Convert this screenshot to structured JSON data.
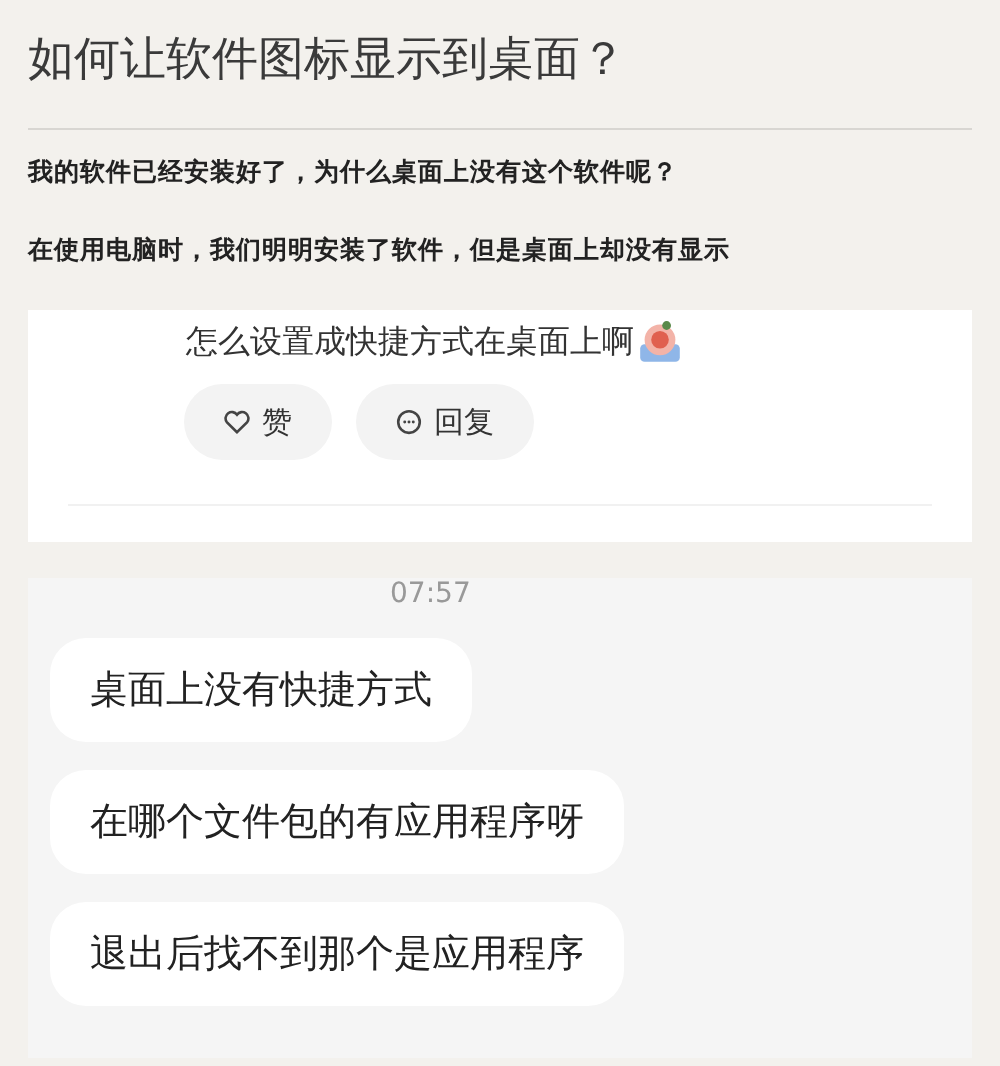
{
  "title": "如何让软件图标显示到桌面？",
  "paragraphs": [
    "我的软件已经安装好了，为什么桌面上没有这个软件呢？",
    "在使用电脑时，我们明明安装了软件，但是桌面上却没有显示"
  ],
  "comment": {
    "text": "怎么设置成快捷方式在桌面上啊",
    "actions": [
      {
        "label": "赞",
        "kind": "like"
      },
      {
        "label": "回复",
        "kind": "reply"
      }
    ]
  },
  "chat": {
    "time": "07:57",
    "messages": [
      "桌面上没有快捷方式",
      "在哪个文件包的有应用程序呀",
      "退出后找不到那个是应用程序"
    ]
  }
}
